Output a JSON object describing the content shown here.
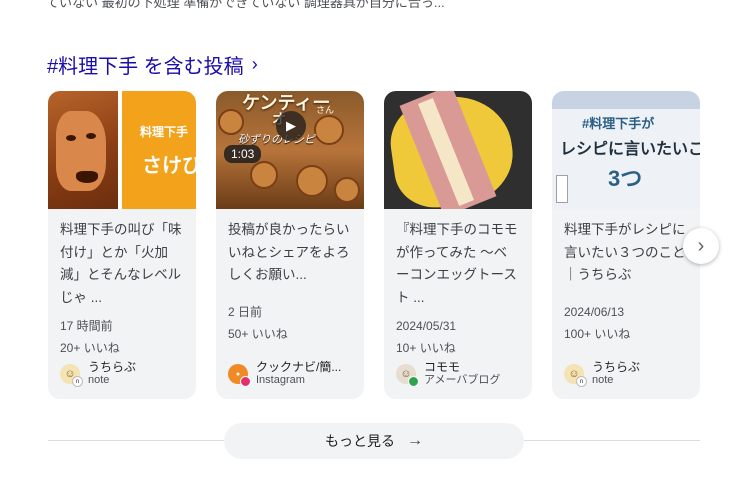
{
  "top_text": "ていない 最初の下処理 準備ができていない 調理器具が自分に合っ...",
  "section": {
    "title": "#料理下手 を含む投稿",
    "chevron": "›"
  },
  "cards": [
    {
      "thumb_text": [
        "料理下手",
        "さけび"
      ],
      "snippet": "料理下手の叫び「味付け」とか「火加減」とそんなレベルじゃ ...",
      "time": "17 時間前",
      "likes": "20+ いいね",
      "source_name": "うちらぶ",
      "source_site": "note",
      "source_icon": "note-avatar-icon"
    },
    {
      "thumb_text": [
        "ケンティー",
        "さん",
        "オ",
        "砂ずりのレシピ"
      ],
      "duration": "1:03",
      "snippet": "投稿が良かったらいいねとシェアをよろしくお願い...",
      "time": "2 日前",
      "likes": "50+ いいね",
      "source_name": "クックナビ/簡...",
      "source_site": "Instagram",
      "source_icon": "instagram-avatar-icon"
    },
    {
      "snippet": "『料理下手のコモモが作ってみた 〜ベーコンエッグトースト ...",
      "time": "2024/05/31",
      "likes": "10+ いいね",
      "source_name": "コモモ",
      "source_site": "アメーバブログ",
      "source_icon": "ameba-avatar-icon"
    },
    {
      "thumb_text": [
        "#料理下手が",
        "レシピに言いたいこと",
        "3つ"
      ],
      "snippet": "料理下手がレシピに言いたい３つのこと｜うちらぶ",
      "time": "2024/06/13",
      "likes": "100+ いいね",
      "source_name": "うちらぶ",
      "source_site": "note",
      "source_icon": "note-avatar-icon"
    }
  ],
  "next_button": "›",
  "more_button": {
    "label": "もっと見る",
    "arrow": "→"
  },
  "colors": {
    "title": "#1a0dab",
    "card_bg": "#f1f3f4",
    "accent_orange": "#f2a21b"
  }
}
